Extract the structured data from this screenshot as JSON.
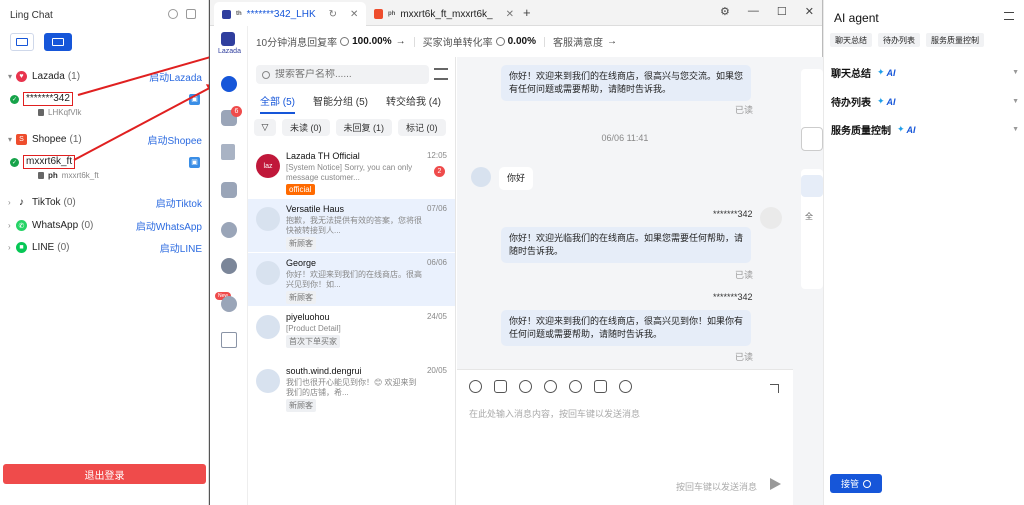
{
  "left_panel": {
    "title": "Ling Chat",
    "logout": "退出登录",
    "platforms": [
      {
        "name": "Lazada",
        "count": "(1)",
        "launch": "启动Lazada",
        "color": "#e8344d"
      },
      {
        "name": "Shopee",
        "count": "(1)",
        "launch": "启动Shopee",
        "color": "#ee4d2d"
      },
      {
        "name": "TikTok",
        "count": "(0)",
        "launch": "启动Tiktok",
        "color": "#111111"
      },
      {
        "name": "WhatsApp",
        "count": "(0)",
        "launch": "启动WhatsApp",
        "color": "#25d366"
      },
      {
        "name": "LINE",
        "count": "(0)",
        "launch": "启动LINE",
        "color": "#06c755"
      }
    ],
    "accounts": [
      {
        "name": "*******342",
        "sub": "LHKqfVlk"
      },
      {
        "name": "mxxrt6k_ft",
        "sub_prefix": "ph",
        "sub": "mxxrt6k_ft"
      }
    ]
  },
  "window": {
    "tabs": [
      {
        "prefix": "th",
        "label": "*******342_LHK"
      },
      {
        "prefix": "ph",
        "label": "mxxrt6k_ft_mxxrt6k_"
      }
    ]
  },
  "rail": {
    "logo_label": "Lazada",
    "badge": "6",
    "new_label": "New"
  },
  "stats": [
    {
      "label": "10分钟消息回复率",
      "value": "100.00%"
    },
    {
      "label": "买家询单转化率",
      "value": "0.00%"
    },
    {
      "label": "客服满意度",
      "value": ""
    }
  ],
  "conversation_list": {
    "search_placeholder": "搜索客户名称......",
    "tabs": [
      "全部 (5)",
      "智能分组 (5)",
      "转交给我 (4)"
    ],
    "filters": [
      "未读 (0)",
      "未回复 (1)",
      "标记 (0)"
    ],
    "items": [
      {
        "name": "Lazada TH Official",
        "date": "12:05",
        "preview": "[System Notice] Sorry, you can only message customer...",
        "tag": "official",
        "unread": "2",
        "avatar": "laz"
      },
      {
        "name": "Versatile Haus",
        "date": "07/06",
        "preview": "抱歉，我无法提供有效的答案，您将很快被转接到人...",
        "tag": "新顾客"
      },
      {
        "name": "George",
        "date": "06/06",
        "preview": "你好！欢迎来到我们的在线商店。很高兴见到你！如...",
        "tag": "新顾客"
      },
      {
        "name": "piyeluohou",
        "date": "24/05",
        "preview": "[Product Detail]",
        "tag": "首次下单买家"
      },
      {
        "name": "south.wind.dengrui",
        "date": "20/05",
        "preview": "我们也很开心能见到你！😊 欢迎来到我们的店铺，希...",
        "tag": "新顾客"
      }
    ]
  },
  "chat": {
    "messages": {
      "m1": "你好！欢迎来到我们的在线商店，很高兴与您交流。如果您有任何问题或需要帮助，请随时告诉我。",
      "m1_status": "已读",
      "time": "06/06 11:41",
      "m2": "你好",
      "m3_sender": "*******342",
      "m3": "你好！欢迎光临我们的在线商店。如果您需要任何帮助，请随时告诉我。",
      "m3_status": "已读",
      "m4_sender": "*******342",
      "m4": "你好！欢迎来到我们的在线商店，很高兴见到你！如果你有任何问题或需要帮助，请随时告诉我。",
      "m4_status": "已读"
    },
    "composer_placeholder": "在此处输入消息内容，按回车键以发送消息",
    "send_hint": "按回车键以发送消息",
    "strip_text": "全"
  },
  "ai_panel": {
    "title": "AI agent",
    "chips": [
      "聊天总结",
      "待办列表",
      "服务质量控制"
    ],
    "sections": [
      "聊天总结",
      "待办列表",
      "服务质量控制"
    ],
    "ai_label": "AI",
    "takeover": "接管"
  }
}
